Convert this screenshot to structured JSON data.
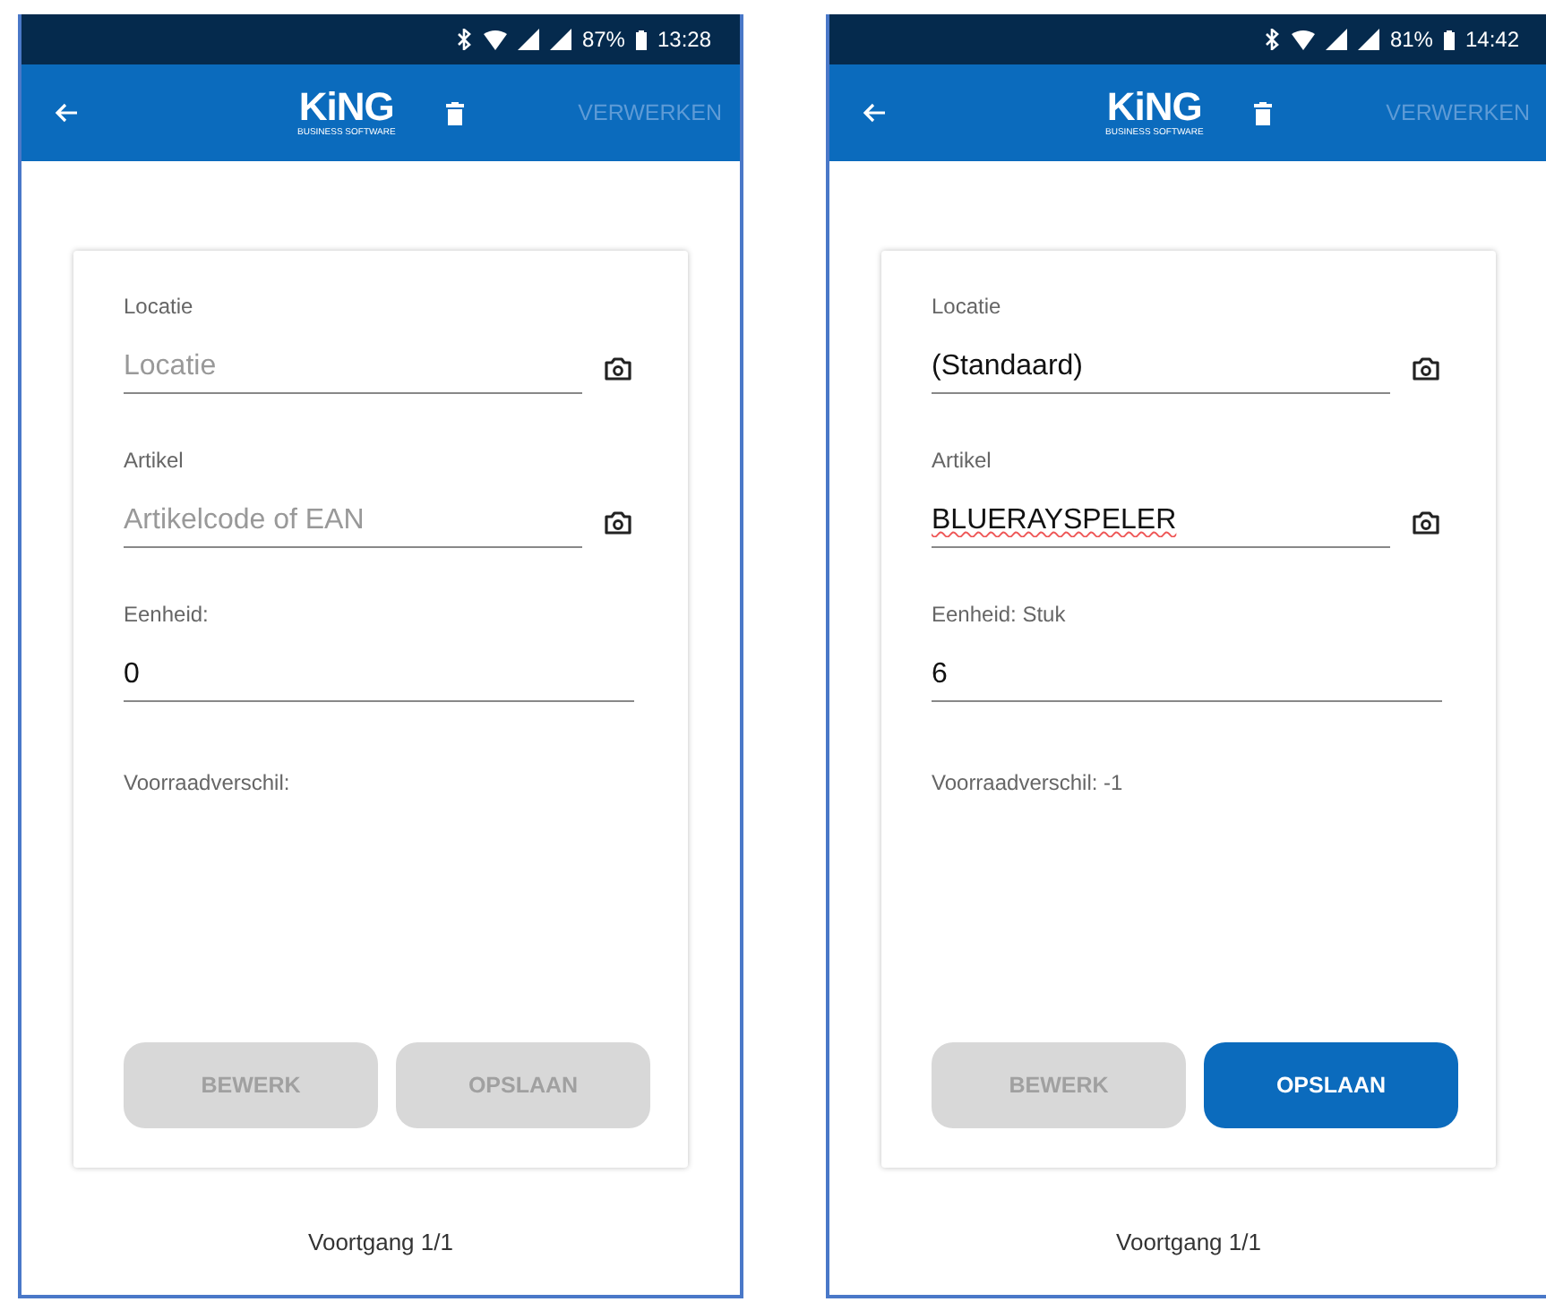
{
  "screens": [
    {
      "status_bar": {
        "battery": "87%",
        "time": "13:28"
      },
      "app_bar": {
        "logo": "KiNG",
        "logo_sub": "BUSINESS SOFTWARE",
        "action": "VERWERKEN"
      },
      "fields": [
        {
          "label": "Locatie",
          "placeholder": "Locatie",
          "camera": true,
          "misspelled": false
        },
        {
          "label": "Artikel",
          "placeholder": "Artikelcode of EAN",
          "camera": true,
          "misspelled": false
        },
        {
          "label": "Eenheid:",
          "value": "0",
          "camera": false,
          "misspelled": false
        }
      ],
      "difference": "Voorraadverschil:",
      "buttons": [
        {
          "label": "BEWERK",
          "enabled": false
        },
        {
          "label": "OPSLAAN",
          "enabled": false
        }
      ],
      "progress": "Voortgang 1/1"
    },
    {
      "status_bar": {
        "battery": "81%",
        "time": "14:42"
      },
      "app_bar": {
        "logo": "KiNG",
        "logo_sub": "BUSINESS SOFTWARE",
        "action": "VERWERKEN"
      },
      "fields": [
        {
          "label": "Locatie",
          "value": "(Standaard)",
          "camera": true,
          "misspelled": false
        },
        {
          "label": "Artikel",
          "value": "BLUERAYSPELER",
          "camera": true,
          "misspelled": true
        },
        {
          "label": "Eenheid: Stuk",
          "value": "6",
          "camera": false,
          "misspelled": false
        }
      ],
      "difference": "Voorraadverschil: -1",
      "buttons": [
        {
          "label": "BEWERK",
          "enabled": false
        },
        {
          "label": "OPSLAAN",
          "enabled": true
        }
      ],
      "progress": "Voortgang 1/1"
    }
  ]
}
